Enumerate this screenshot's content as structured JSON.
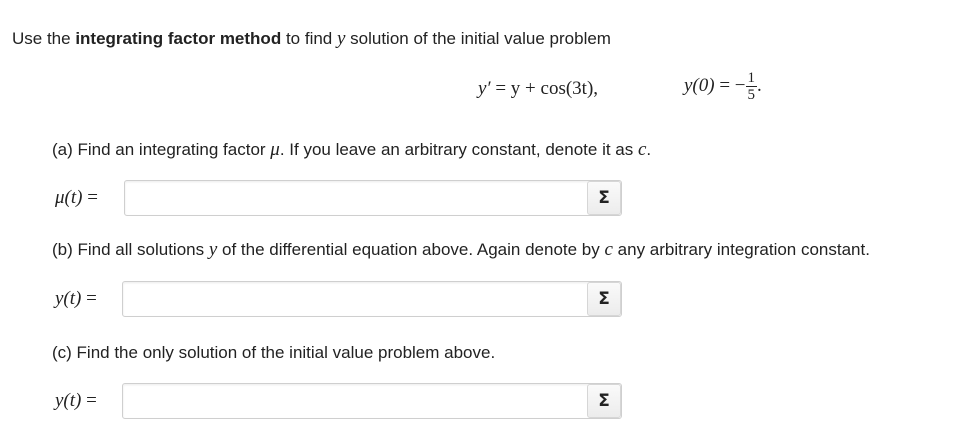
{
  "intro": {
    "prefix": "Use the ",
    "bold": "integrating factor method",
    "middle": " to find ",
    "var": "y",
    "suffix": " solution of the initial value problem"
  },
  "equation": {
    "ode_lhs": "y′",
    "ode_rhs": " = y + cos(3t),",
    "ic_lhs": "y(0)",
    "ic_eq": " = −",
    "ic_num": "1",
    "ic_den": "5",
    "ic_end": "."
  },
  "part_a": {
    "text_1": "(a) Find an integrating factor ",
    "mu": "μ",
    "text_2": ". If you leave an arbitrary constant, denote it as ",
    "c": "c",
    "text_3": ".",
    "label_fn": "μ(t)",
    "label_eq": " =",
    "input_value": "",
    "sigma": "Σ"
  },
  "part_b": {
    "text_1": "(b) Find all solutions ",
    "y": "y",
    "text_2": " of the differential equation above. Again denote by ",
    "c": "c",
    "text_3": " any arbitrary integration constant.",
    "label_fn": "y(t)",
    "label_eq": " =",
    "input_value": "",
    "sigma": "Σ"
  },
  "part_c": {
    "text": "(c) Find the only solution of the initial value problem above.",
    "label_fn": "y(t)",
    "label_eq": " =",
    "input_value": "",
    "sigma": "Σ"
  }
}
